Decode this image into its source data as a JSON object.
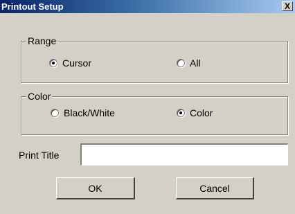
{
  "window": {
    "title": "Printout Setup",
    "close_glyph": "X"
  },
  "range": {
    "legend": "Range",
    "options": [
      {
        "label": "Cursor",
        "checked": true
      },
      {
        "label": "All",
        "checked": false
      }
    ]
  },
  "color": {
    "legend": "Color",
    "options": [
      {
        "label": "Black/White",
        "checked": false
      },
      {
        "label": "Color",
        "checked": true
      }
    ]
  },
  "print_title": {
    "label": "Print Title",
    "value": ""
  },
  "buttons": {
    "ok": "OK",
    "cancel": "Cancel"
  },
  "colors": {
    "face": "#d4d0c8",
    "titlebar_start": "#0a246a",
    "titlebar_end": "#a6caf0"
  }
}
